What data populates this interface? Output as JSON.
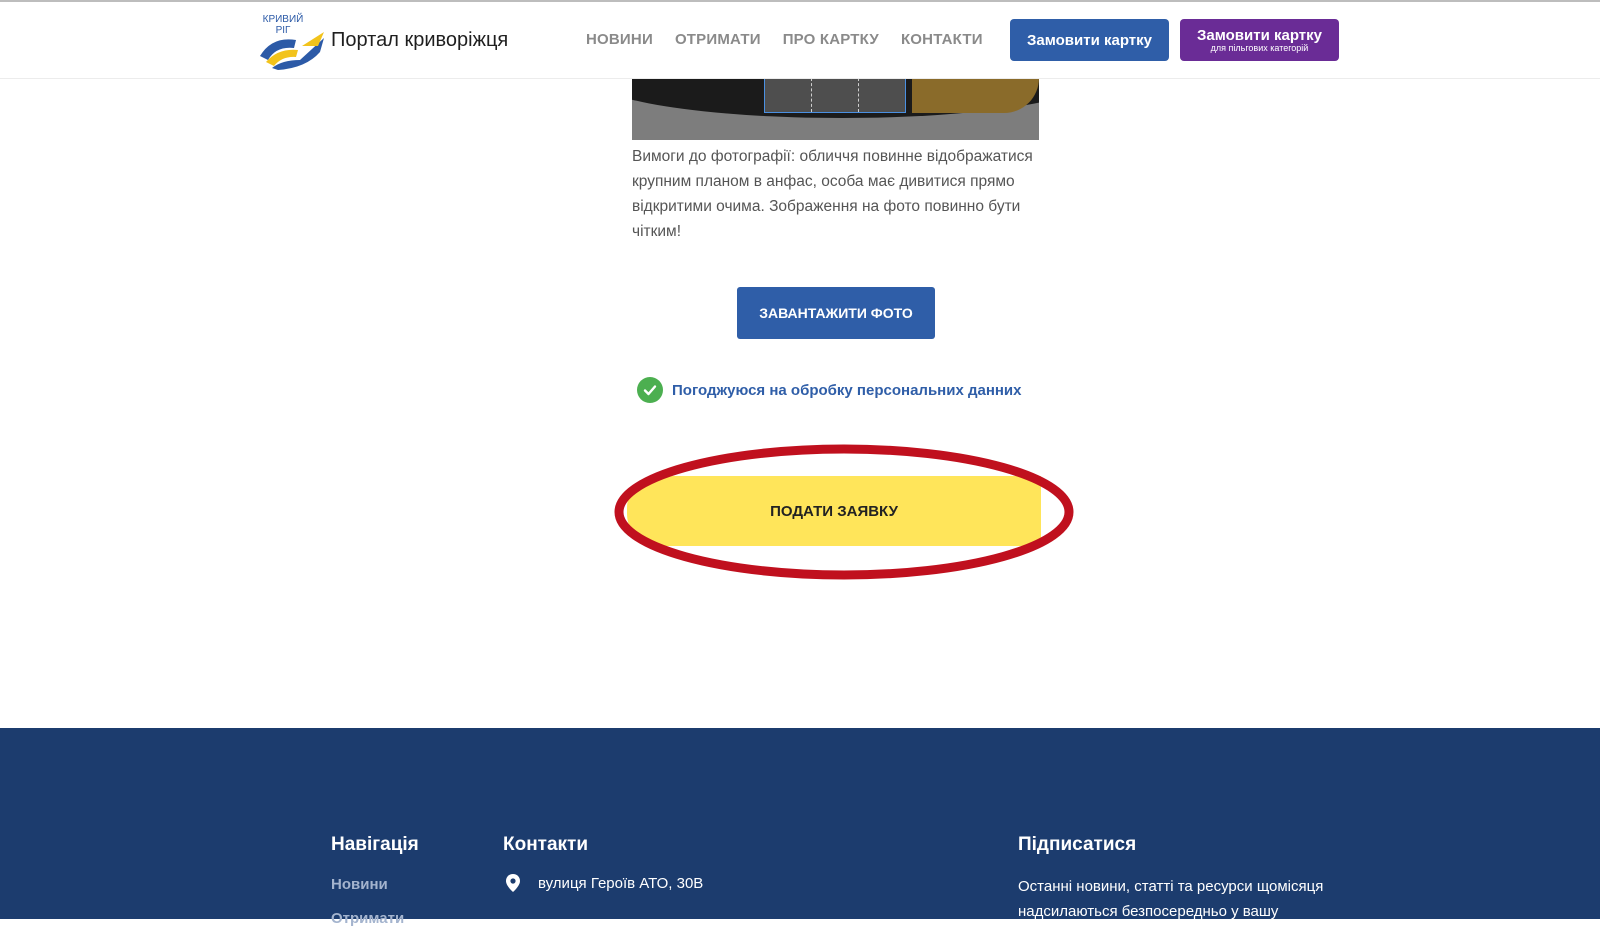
{
  "header": {
    "logo_city_line1": "КРИВИЙ",
    "logo_city_line2": "РІГ",
    "site_title": "Портал криворіжця",
    "nav": [
      "НОВИНИ",
      "ОТРИМАТИ",
      "ПРО КАРТКУ",
      "КОНТАКТИ"
    ],
    "order_button": "Замовити картку",
    "order_benefit_button": {
      "main": "Замовити картку",
      "sub": "для пільгових категорій"
    }
  },
  "main": {
    "photo_requirements": "Вимоги до фотографії: обличчя повинне відображатися крупним планом в анфас, особа має дивитися прямо відкритими очима. Зображення на фото повинно бути чітким!",
    "upload_button": "ЗАВАНТАЖИТИ ФОТО",
    "consent_label": "Погоджуюся на обробку персональних данних",
    "consent_checked": true,
    "submit_button": "ПОДАТИ ЗАЯВКУ"
  },
  "footer": {
    "navigation_title": "Навігація",
    "navigation_links": [
      "Новини",
      "Отримати"
    ],
    "contacts_title": "Контакти",
    "address": "вулиця Героїв АТО, 30В",
    "subscribe_title": "Підписатися",
    "subscribe_text": "Останні новини, статті та ресурси щомісяця надсилаються безпосередньо у вашу"
  },
  "colors": {
    "primary_blue": "#2f5ea8",
    "purple": "#6a2c96",
    "submit_yellow": "#ffe55a",
    "footer_bg": "#1c3c6e",
    "highlight_red": "#c0101e",
    "check_green": "#4caf50"
  }
}
